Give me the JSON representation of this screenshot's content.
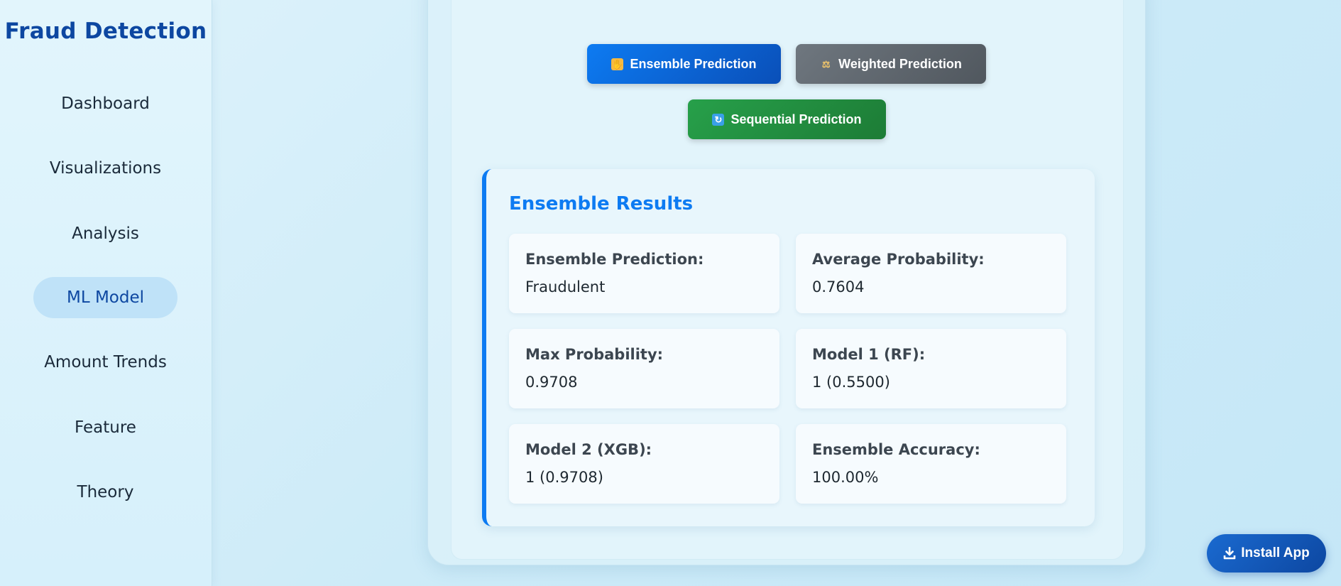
{
  "sidebar": {
    "brand": "Fraud Detection",
    "items": [
      {
        "label": "Dashboard",
        "active": false
      },
      {
        "label": "Visualizations",
        "active": false
      },
      {
        "label": "Analysis",
        "active": false
      },
      {
        "label": "ML Model",
        "active": true
      },
      {
        "label": "Amount Trends",
        "active": false
      },
      {
        "label": "Feature",
        "active": false
      },
      {
        "label": "Theory",
        "active": false
      }
    ]
  },
  "actions": {
    "ensemble": {
      "label": "Ensemble Prediction",
      "icon": "handshake-icon"
    },
    "weighted": {
      "label": "Weighted Prediction",
      "icon": "balance-scale-icon"
    },
    "sequential": {
      "label": "Sequential Prediction",
      "icon": "cycle-arrows-icon"
    }
  },
  "results": {
    "title": "Ensemble Results",
    "cells": [
      {
        "label": "Ensemble Prediction:",
        "value": "Fraudulent"
      },
      {
        "label": "Average Probability:",
        "value": "0.7604"
      },
      {
        "label": "Max Probability:",
        "value": "0.9708"
      },
      {
        "label": "Model 1 (RF):",
        "value": "1 (0.5500)"
      },
      {
        "label": "Model 2 (XGB):",
        "value": "1 (0.9708)"
      },
      {
        "label": "Ensemble Accuracy:",
        "value": "100.00%"
      }
    ]
  },
  "install": {
    "label": "Install App",
    "icon": "download-icon"
  },
  "colors": {
    "brand": "#0d47a1",
    "accent": "#0d7bf2",
    "success": "#27a04a",
    "neutral": "#6f777f"
  }
}
